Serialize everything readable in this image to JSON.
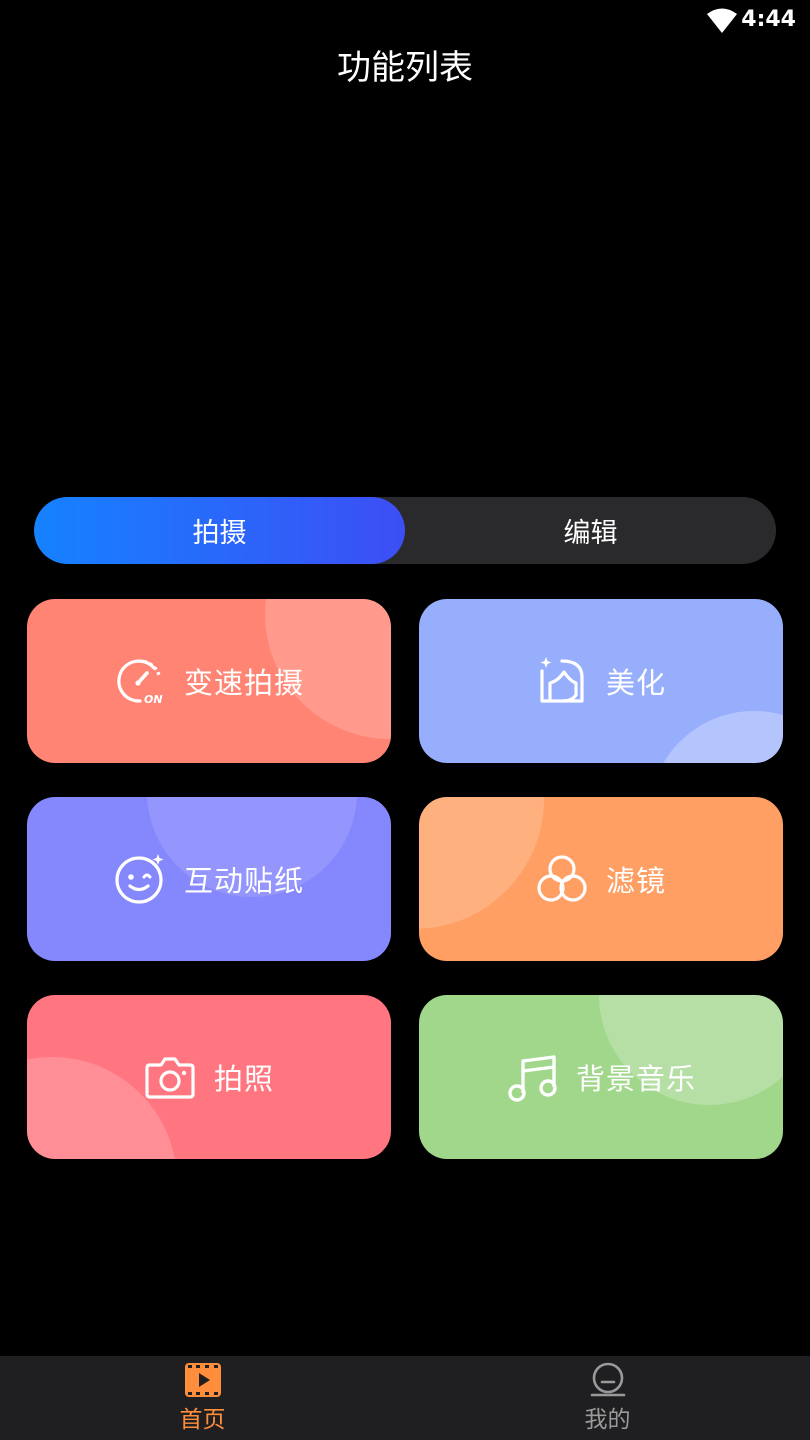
{
  "status_bar": {
    "time": "4:44"
  },
  "header": {
    "title": "功能列表"
  },
  "tabs": [
    {
      "label": "拍摄",
      "active": true
    },
    {
      "label": "编辑",
      "active": false
    }
  ],
  "features": [
    {
      "label": "变速拍摄",
      "icon": "speed-dial-icon",
      "color": "#ff8474"
    },
    {
      "label": "美化",
      "icon": "face-beauty-icon",
      "color": "#97aefc"
    },
    {
      "label": "互动贴纸",
      "icon": "smiley-sticker-icon",
      "color": "#8587fd"
    },
    {
      "label": "滤镜",
      "icon": "filter-circles-icon",
      "color": "#ff9f63"
    },
    {
      "label": "拍照",
      "icon": "camera-icon",
      "color": "#ff7681"
    },
    {
      "label": "背景音乐",
      "icon": "music-note-icon",
      "color": "#a0d78b"
    }
  ],
  "speed_icon_badge": "ON",
  "bottom_nav": [
    {
      "label": "首页",
      "icon": "video-play-icon",
      "active": true,
      "color": "#ff8e3c"
    },
    {
      "label": "我的",
      "icon": "profile-icon",
      "active": false,
      "color": "#9a9a9a"
    }
  ]
}
